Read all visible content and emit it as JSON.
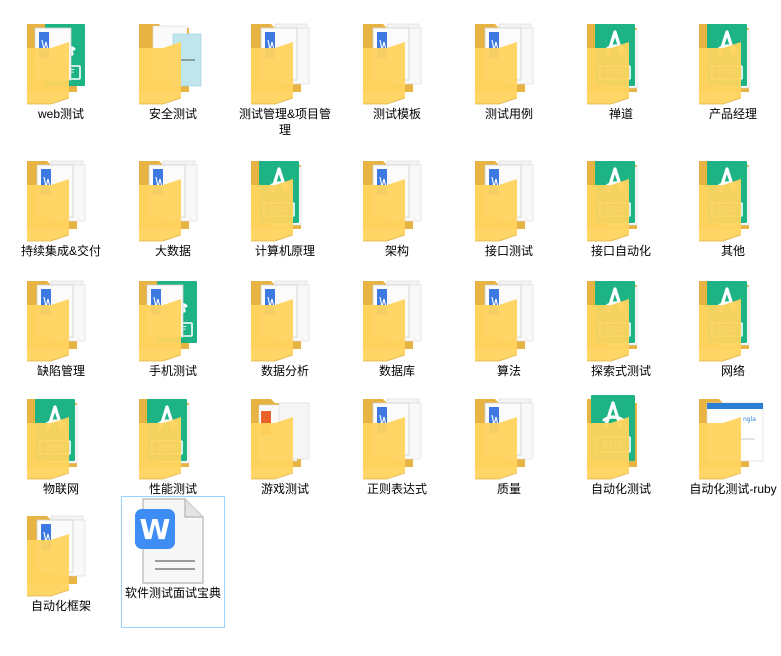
{
  "items": [
    {
      "label": "web测试",
      "kind": "folder-word-pdf"
    },
    {
      "label": "安全测试",
      "kind": "folder-docs-image"
    },
    {
      "label": "测试管理&项目管理",
      "kind": "folder-word"
    },
    {
      "label": "测试模板",
      "kind": "folder-word"
    },
    {
      "label": "测试用例",
      "kind": "folder-word"
    },
    {
      "label": "禅道",
      "kind": "folder-pdf"
    },
    {
      "label": "产品经理",
      "kind": "folder-pdf"
    },
    {
      "label": "持续集成&交付",
      "kind": "folder-word"
    },
    {
      "label": "大数据",
      "kind": "folder-word"
    },
    {
      "label": "计算机原理",
      "kind": "folder-pdf"
    },
    {
      "label": "架构",
      "kind": "folder-word"
    },
    {
      "label": "接口测试",
      "kind": "folder-word"
    },
    {
      "label": "接口自动化",
      "kind": "folder-pdf"
    },
    {
      "label": "其他",
      "kind": "folder-pdf"
    },
    {
      "label": "缺陷管理",
      "kind": "folder-word"
    },
    {
      "label": "手机测试",
      "kind": "folder-word-pdf"
    },
    {
      "label": "数据分析",
      "kind": "folder-word"
    },
    {
      "label": "数据库",
      "kind": "folder-word"
    },
    {
      "label": "算法",
      "kind": "folder-word"
    },
    {
      "label": "探索式测试",
      "kind": "folder-pdf"
    },
    {
      "label": "网络",
      "kind": "folder-pdf"
    },
    {
      "label": "物联网",
      "kind": "folder-pdf"
    },
    {
      "label": "性能测试",
      "kind": "folder-pdf"
    },
    {
      "label": "游戏测试",
      "kind": "folder-ppt"
    },
    {
      "label": "正则表达式",
      "kind": "folder-word"
    },
    {
      "label": "质量",
      "kind": "folder-word"
    },
    {
      "label": "自动化测试",
      "kind": "folder-pdf-big"
    },
    {
      "label": "自动化测试-ruby",
      "kind": "folder-image"
    },
    {
      "label": "自动化框架",
      "kind": "folder-word"
    },
    {
      "label": "软件测试面试宝典",
      "kind": "wps-document"
    }
  ],
  "colors": {
    "folder_back": "#e7b443",
    "folder_front": "#ffd45e",
    "pdf_green": "#1db384",
    "word_blue": "#3d79e0",
    "ppt_orange": "#e8622a",
    "wps_blue": "#3d8df5",
    "selection_border": "#99d1ff"
  },
  "pdf_text": "PDF",
  "wps_letter": "W"
}
